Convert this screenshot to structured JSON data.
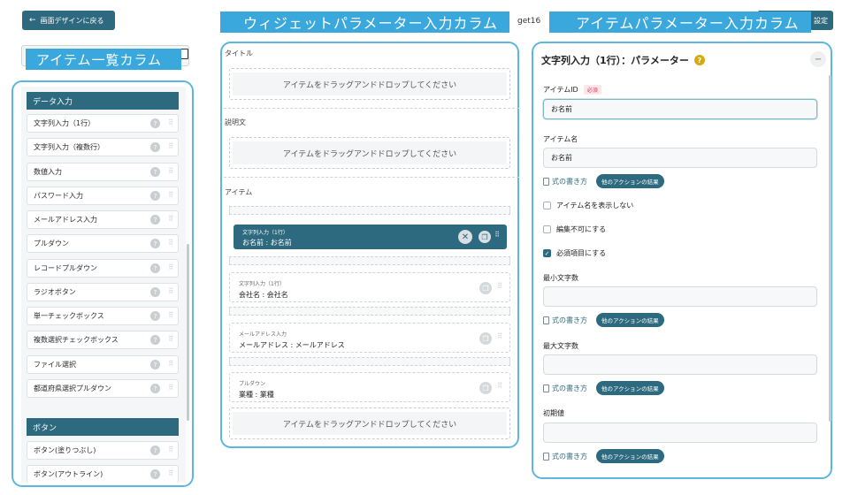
{
  "toolbar": {
    "back_label": "画面デザインに戻る",
    "widget_tab_label": "get16",
    "settings_label": "設定"
  },
  "callouts": {
    "item_list": "アイテム一覧カラム",
    "widget_params": "ウィジェットパラメーター入力カラム",
    "item_params": "アイテムパラメーター入力カラム"
  },
  "left": {
    "sections": [
      {
        "title": "データ入力",
        "items": [
          "文字列入力（1行）",
          "文字列入力（複数行）",
          "数値入力",
          "パスワード入力",
          "メールアドレス入力",
          "プルダウン",
          "レコードプルダウン",
          "ラジオボタン",
          "単一チェックボックス",
          "複数選択チェックボックス",
          "ファイル選択",
          "都道府県選択プルダウン"
        ]
      },
      {
        "title": "ボタン",
        "items": [
          "ボタン(塗りつぶし)",
          "ボタン(アウトライン)"
        ]
      }
    ]
  },
  "middle": {
    "title_label": "タイトル",
    "description_label": "説明文",
    "items_label": "アイテム",
    "drop_text": "アイテムをドラッグアンドドロップしてください",
    "widgets": [
      {
        "type": "文字列入力（1行）",
        "value": "お名前 : お名前",
        "selected": true
      },
      {
        "type": "文字列入力（1行）",
        "value": "会社名 : 会社名",
        "selected": false
      },
      {
        "type": "メールアドレス入力",
        "value": "メールアドレス : メールアドレス",
        "selected": false
      },
      {
        "type": "プルダウン",
        "value": "業種 : 業種",
        "selected": false
      }
    ]
  },
  "right": {
    "title": "文字列入力（1行）：パラメーター",
    "item_id_label": "アイテムID",
    "required_badge": "必須",
    "item_id_value": "お名前",
    "item_name_label": "アイテム名",
    "item_name_value": "お名前",
    "formula_link": "式の書き方",
    "action_pill": "他のアクションの結果",
    "checkboxes": [
      {
        "label": "アイテム名を表示しない",
        "checked": false
      },
      {
        "label": "編集不可にする",
        "checked": false
      },
      {
        "label": "必須項目にする",
        "checked": true
      }
    ],
    "min_length_label": "最小文字数",
    "max_length_label": "最大文字数",
    "initial_value_label": "初期値"
  }
}
